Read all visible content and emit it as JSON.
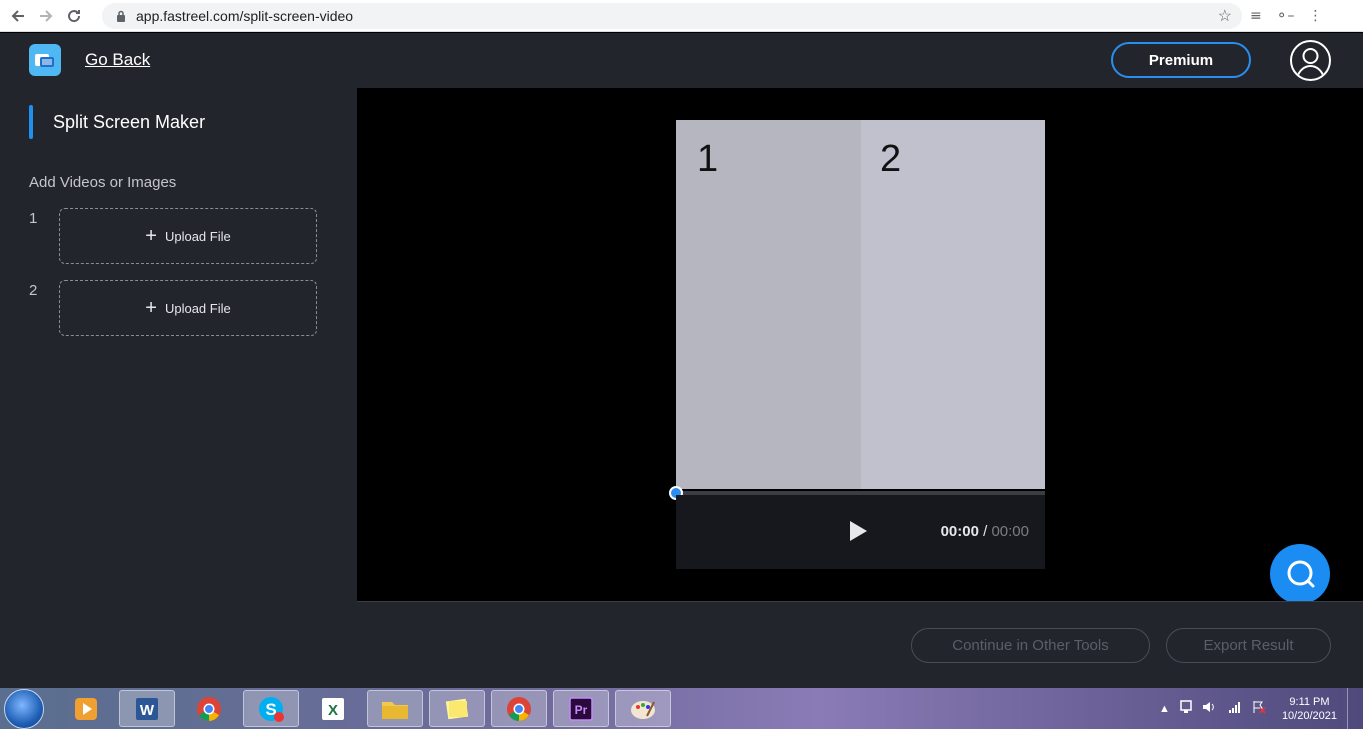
{
  "browser": {
    "url": "app.fastreel.com/split-screen-video"
  },
  "header": {
    "go_back": "Go Back",
    "premium": "Premium"
  },
  "sidebar": {
    "title": "Split Screen Maker",
    "subtitle": "Add Videos or Images",
    "slots": [
      {
        "number": "1",
        "upload_label": "Upload File"
      },
      {
        "number": "2",
        "upload_label": "Upload File"
      }
    ]
  },
  "player": {
    "panels": [
      "1",
      "2"
    ],
    "current_time": "00:00",
    "separator": "/",
    "total_time": "00:00",
    "progress": 0
  },
  "footer": {
    "continue": "Continue in Other Tools",
    "export": "Export Result"
  },
  "taskbar": {
    "time": "9:11 PM",
    "date": "10/20/2021"
  },
  "colors": {
    "accent": "#1a8cf2",
    "panel_bg": "#23252d",
    "stage_bg": "#000000"
  }
}
